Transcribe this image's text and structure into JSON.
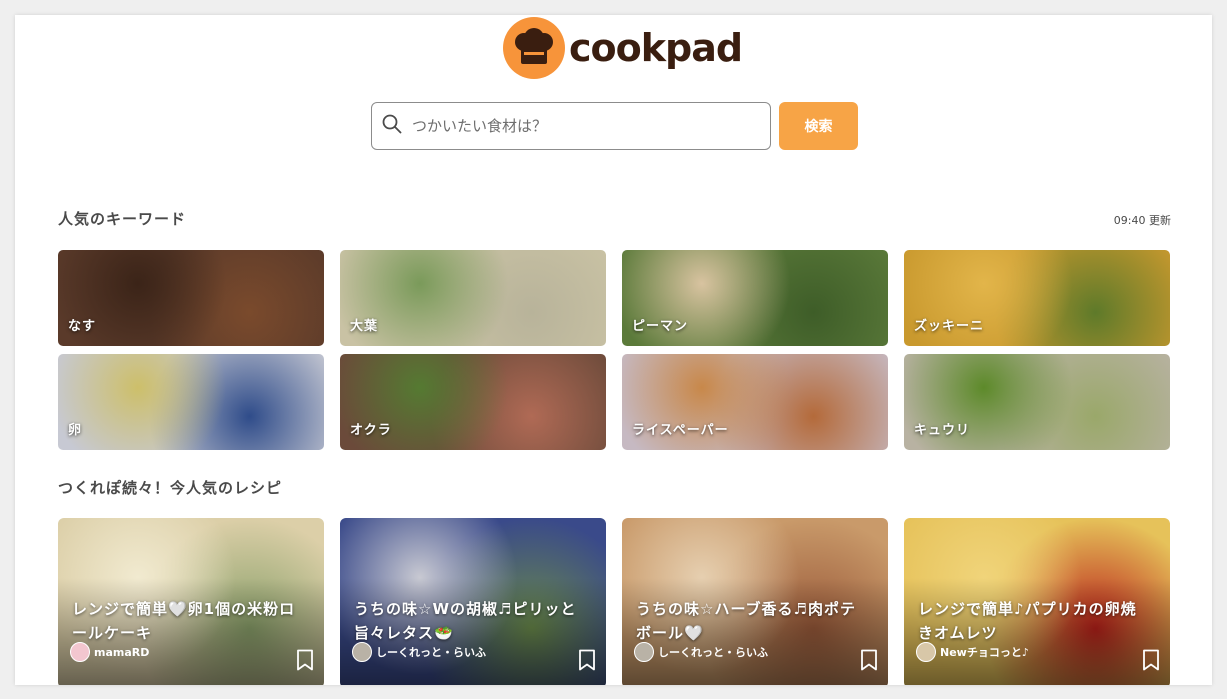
{
  "brand": {
    "name": "cookpad"
  },
  "search": {
    "placeholder": "つかいたい食材は？",
    "button_label": "検索"
  },
  "keywords_section": {
    "title": "人気のキーワード",
    "updated": "09:40 更新",
    "items": [
      {
        "label": "なす",
        "colors": [
          "#5a3a2a",
          "#3b2418",
          "#7a4a2c"
        ]
      },
      {
        "label": "大葉",
        "colors": [
          "#c9c2a4",
          "#7a9a5a",
          "#b8b39a"
        ]
      },
      {
        "label": "ピーマン",
        "colors": [
          "#5b7a3a",
          "#d8c3a0",
          "#3e5d28"
        ]
      },
      {
        "label": "ズッキーニ",
        "colors": [
          "#c9992e",
          "#e2b54a",
          "#5e7a2a"
        ]
      },
      {
        "label": "卵",
        "colors": [
          "#c7c9d3",
          "#cdbf6a",
          "#2f4c8a"
        ]
      },
      {
        "label": "オクラ",
        "colors": [
          "#6b4a3a",
          "#557a32",
          "#b06a55"
        ]
      },
      {
        "label": "ライスペーパー",
        "colors": [
          "#c6b9c2",
          "#c8884a",
          "#b46a3a"
        ]
      },
      {
        "label": "キュウリ",
        "colors": [
          "#b8b2a2",
          "#5d8a2a",
          "#9aa86a"
        ]
      }
    ]
  },
  "recipes_section": {
    "title": "つくれぽ続々！今人気のレシピ",
    "items": [
      {
        "title": "レンジで簡単🤍卵1個の米粉ロールケーキ",
        "author": "mamaRD",
        "colors": [
          "#dccfa8",
          "#f1ead0",
          "#8aa06a"
        ]
      },
      {
        "title": "うちの味☆Wの胡椒♬ピリッと旨々レタス🥗",
        "author": "しーくれっと・らいふ",
        "colors": [
          "#3a4a8a",
          "#c8c9d2",
          "#6a8a4a"
        ]
      },
      {
        "title": "うちの味☆ハーブ香る♬肉ポテボール🤍",
        "author": "しーくれっと・らいふ",
        "colors": [
          "#c99a6a",
          "#e6cfb0",
          "#9a5a3a"
        ]
      },
      {
        "title": "レンジで簡単♪パプリカの卵焼きオムレツ",
        "author": "Newチョコっと♪",
        "colors": [
          "#e6c25a",
          "#f0d47a",
          "#b8201a"
        ]
      }
    ]
  }
}
